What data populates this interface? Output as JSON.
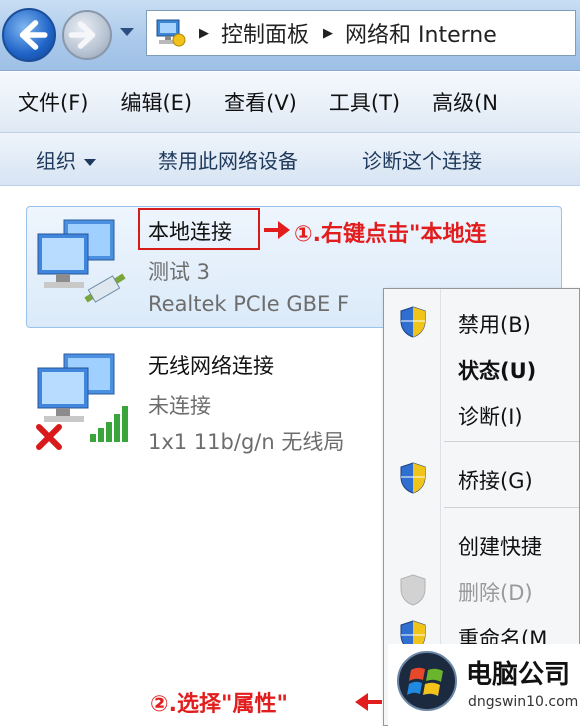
{
  "address_bar": {
    "breadcrumbs": [
      "控制面板",
      "网络和 Interne"
    ]
  },
  "menu": [
    "文件(F)",
    "编辑(E)",
    "查看(V)",
    "工具(T)",
    "高级(N"
  ],
  "toolbar": {
    "organize": "组织",
    "disable": "禁用此网络设备",
    "diagnose": "诊断这个连接"
  },
  "connections": [
    {
      "name": "本地连接",
      "status": "测试 3",
      "device": "Realtek PCIe GBE F"
    },
    {
      "name": "无线网络连接",
      "status": "未连接",
      "device": "1x1 11b/g/n 无线局"
    }
  ],
  "annotations": {
    "step1": "①.右键点击\"本地连",
    "step2": "②.选择\"属性\""
  },
  "context_menu": [
    {
      "label": "禁用(B)",
      "shield": true,
      "enabled": true,
      "bold": false
    },
    {
      "label": "状态(U)",
      "shield": false,
      "enabled": true,
      "bold": true
    },
    {
      "label": "诊断(I)",
      "shield": false,
      "enabled": true,
      "bold": false
    },
    {
      "label": "桥接(G)",
      "shield": true,
      "enabled": true,
      "bold": false
    },
    {
      "label": "创建快捷",
      "shield": false,
      "enabled": true,
      "bold": false
    },
    {
      "label": "删除(D)",
      "shield": true,
      "enabled": false,
      "bold": false
    },
    {
      "label": "重命名(M",
      "shield": true,
      "enabled": true,
      "bold": false
    }
  ],
  "watermark": {
    "brand": "电脑公司",
    "url": "dngswin10.com"
  },
  "colors": {
    "annotation_red": "#e11d1d",
    "selection": "#dbeaf9"
  }
}
